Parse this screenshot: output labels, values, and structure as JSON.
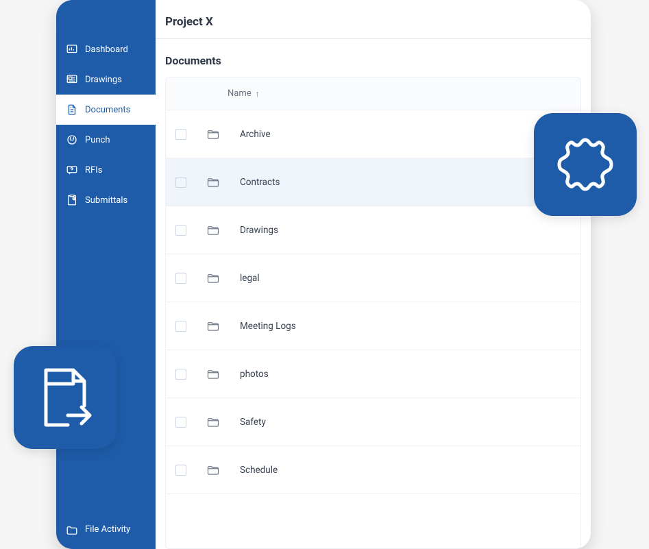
{
  "header": {
    "title": "Project X"
  },
  "section": {
    "title": "Documents"
  },
  "sidebar": {
    "items": [
      {
        "label": "Dashboard",
        "icon": "dashboard-icon"
      },
      {
        "label": "Drawings",
        "icon": "drawings-icon"
      },
      {
        "label": "Documents",
        "icon": "documents-icon"
      },
      {
        "label": "Punch",
        "icon": "punch-icon"
      },
      {
        "label": "RFIs",
        "icon": "rfis-icon"
      },
      {
        "label": "Submittals",
        "icon": "submittals-icon"
      }
    ],
    "footer": {
      "label": "File Activity",
      "icon": "folder-icon"
    },
    "active_index": 2
  },
  "table": {
    "column_label": "Name",
    "sort_indicator": "↑",
    "rows": [
      {
        "name": "Archive"
      },
      {
        "name": "Contracts"
      },
      {
        "name": "Drawings"
      },
      {
        "name": "legal"
      },
      {
        "name": "Meeting Logs"
      },
      {
        "name": "photos"
      },
      {
        "name": "Safety"
      },
      {
        "name": "Schedule"
      }
    ],
    "hovered_index": 1
  },
  "badges": {
    "left": "file-export-icon",
    "right": "outline-badge-icon"
  }
}
